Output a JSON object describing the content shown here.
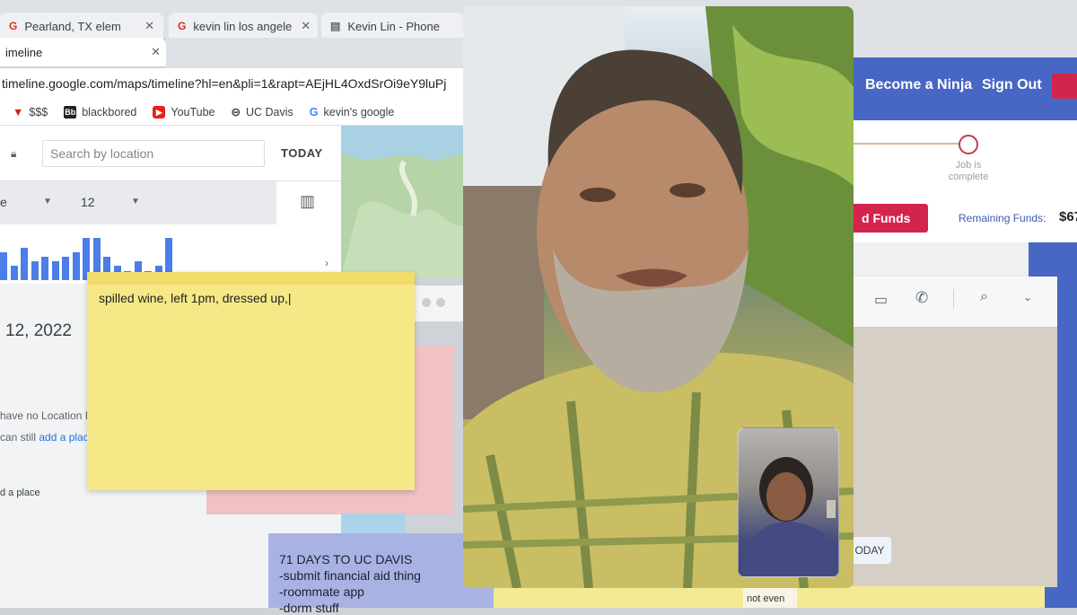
{
  "browser": {
    "tabs": [
      {
        "label": "Pearland, TX elem",
        "icon": "google-icon"
      },
      {
        "label": "kevin lin los angele",
        "icon": "google-icon"
      },
      {
        "label": "Kevin Lin - Phone",
        "icon": "website-icon"
      }
    ],
    "active_tab": "imeline",
    "url": "timeline.google.com/maps/timeline?hl=en&pli=1&rapt=AEjHL4OxdSrOi9eY9luPj",
    "bookmarks": [
      "$$$",
      "blackbored",
      "YouTube",
      "UC Davis",
      "kevin's google"
    ]
  },
  "timeline": {
    "search_placeholder": "Search by location",
    "today_label": "TODAY",
    "month_dropdown": "e",
    "day_dropdown": "12",
    "chart_data": {
      "type": "bar",
      "values": [
        6,
        3,
        7,
        4,
        5,
        4,
        5,
        6,
        9,
        9,
        5,
        3,
        2,
        4,
        2,
        3,
        9
      ]
    },
    "date_heading": "12, 2022",
    "no_location_text": "have no Location I",
    "add_place_prefix": "can still ",
    "add_place_link": "add a plac",
    "add_place_button": "d a place"
  },
  "donate_page": {
    "nav_items": [
      "Become a Ninja",
      "Sign Out"
    ],
    "progress_label_line1": "Job is",
    "progress_label_line2": "complete",
    "fund_button": "d Funds",
    "remaining_label": "Remaining Funds:",
    "remaining_value": "$67"
  },
  "chat_app": {
    "today_button": "ODAY"
  },
  "stickies": {
    "yellow_note": "spilled wine, left 1pm, dressed up,",
    "lavender_note": [
      "71 DAYS TO UC DAVIS",
      "-submit financial aid thing",
      "-roommate app",
      "-dorm stuff"
    ],
    "bottom_note": "not even"
  },
  "colors": {
    "nav_blue": "#4867c4",
    "fund_red": "#d3254c",
    "sticky_yellow": "#f6e887",
    "sticky_lavender": "#a9b3e3",
    "sticky_pink": "#f1c1c3"
  }
}
